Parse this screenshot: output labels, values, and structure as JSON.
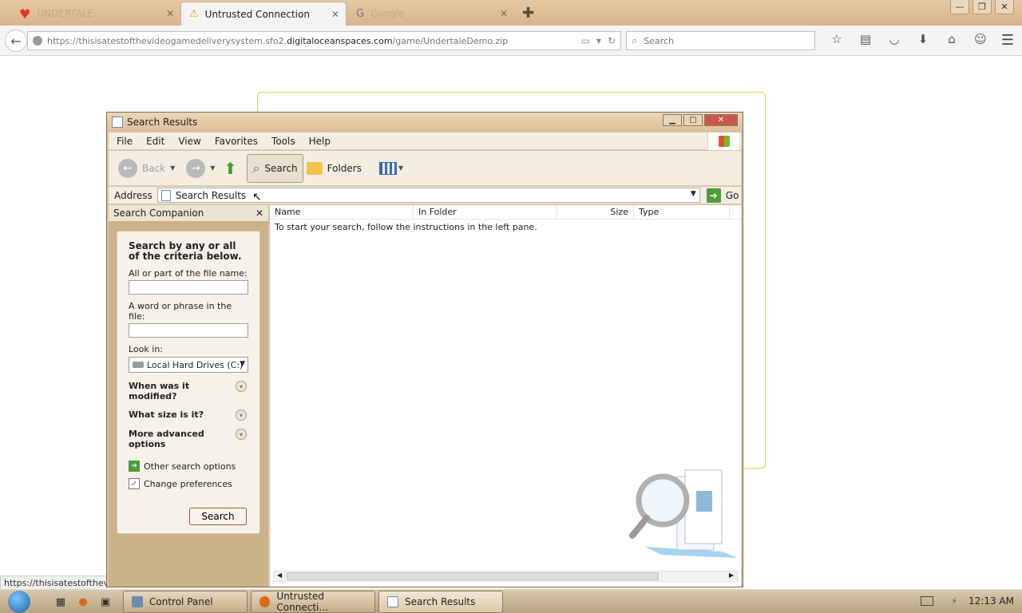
{
  "browser": {
    "tabs": [
      {
        "label": "UNDERTALE",
        "state": "faded"
      },
      {
        "label": "Untrusted Connection",
        "state": "active"
      },
      {
        "label": "Google",
        "state": "faded"
      }
    ],
    "url": {
      "prefix": "https://thisisatestofthevideogamedeliverysystem.sfo2.",
      "domain": "digitaloceanspaces.com",
      "path": "/game/UndertaleDemo.zip"
    },
    "search_placeholder": "Search"
  },
  "status_url": "https://thisisatestofthevid",
  "window": {
    "title": "Search Results",
    "menu": [
      "File",
      "Edit",
      "View",
      "Favorites",
      "Tools",
      "Help"
    ],
    "toolbar": {
      "back": "Back",
      "search": "Search",
      "folders": "Folders"
    },
    "address": {
      "label": "Address",
      "value": "Search Results",
      "go": "Go"
    },
    "companion": {
      "title": "Search Companion",
      "intro": "Search by any or all of the criteria below.",
      "filename_label": "All or part of the file name:",
      "filename_value": "",
      "phrase_label": "A word or phrase in the file:",
      "phrase_value": "",
      "lookin_label": "Look in:",
      "lookin_value": "Local Hard Drives (C:)",
      "expanders": [
        "When was it modified?",
        "What size is it?",
        "More advanced options"
      ],
      "links": [
        "Other search options",
        "Change preferences"
      ],
      "search_button": "Search"
    },
    "results": {
      "columns": [
        "Name",
        "In Folder",
        "Size",
        "Type"
      ],
      "hint": "To start your search, follow the instructions in the left pane."
    }
  },
  "taskbar": {
    "buttons": [
      {
        "label": "Control Panel"
      },
      {
        "label": "Untrusted Connecti..."
      },
      {
        "label": "Search Results"
      }
    ],
    "clock": "12:13 AM"
  },
  "colors": {
    "accent_border": "#f2c24f",
    "chrome": "#d8b48a"
  }
}
